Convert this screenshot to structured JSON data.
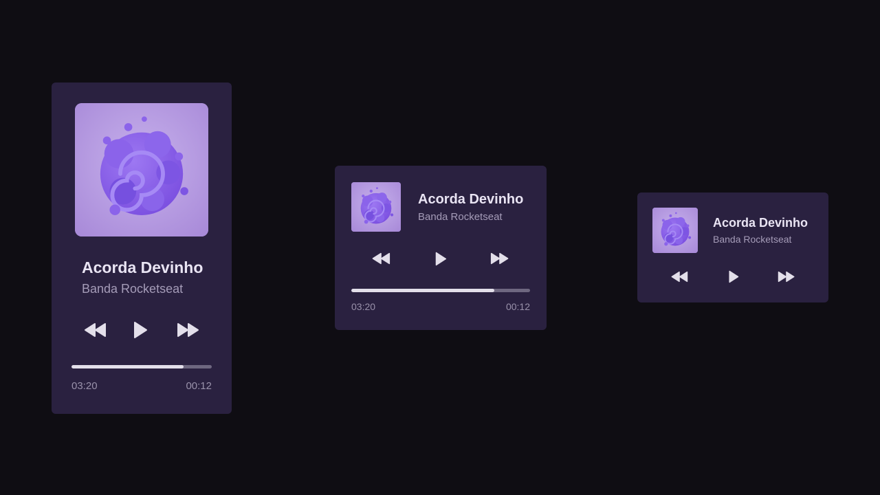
{
  "players": [
    {
      "variant": "vertical",
      "title": "Acorda Devinho",
      "artist": "Banda Rocketseat",
      "cover_art": "album-cover",
      "controls": [
        "rewind-icon",
        "play-icon",
        "fast-forward-icon"
      ],
      "progress": 0.8,
      "time_elapsed": "03:20",
      "time_remaining": "00:12"
    },
    {
      "variant": "medium",
      "title": "Acorda Devinho",
      "artist": "Banda Rocketseat",
      "cover_art": "album-cover",
      "controls": [
        "rewind-icon",
        "play-icon",
        "fast-forward-icon"
      ],
      "progress": 0.8,
      "time_elapsed": "03:20",
      "time_remaining": "00:12"
    },
    {
      "variant": "compact",
      "title": "Acorda Devinho",
      "artist": "Banda Rocketseat",
      "cover_art": "album-cover",
      "controls": [
        "rewind-icon",
        "play-icon",
        "fast-forward-icon"
      ]
    }
  ],
  "colors": {
    "background": "#0f0d13",
    "card": "#2a2140",
    "title": "#e9e4f3",
    "subtitle": "#a59cb8",
    "progress_fill": "#e3dfea",
    "progress_track": "#6e6780",
    "cover_bg": "#b79ce3",
    "cover_art": "#7b4fe0"
  }
}
